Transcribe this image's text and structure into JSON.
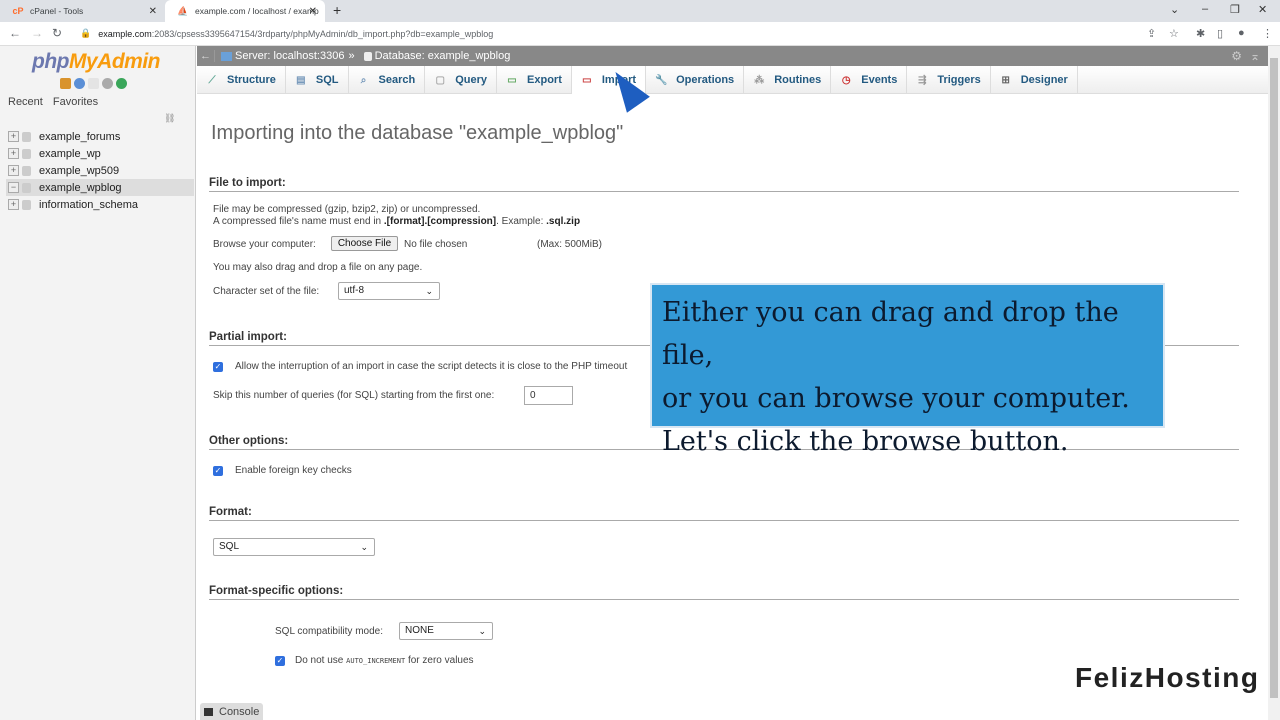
{
  "browser": {
    "tabs": [
      {
        "label": "cPanel - Tools",
        "active": false
      },
      {
        "label": "example.com / localhost / examp",
        "active": true
      }
    ],
    "url_host": "example.com",
    "url_rest": ":2083/cpsess3395647154/3rdparty/phpMyAdmin/db_import.php?db=example_wpblog"
  },
  "sidebar": {
    "logo_php": "php",
    "logo_myadmin": "MyAdmin",
    "tabs": [
      "Recent",
      "Favorites"
    ],
    "databases": [
      {
        "name": "example_forums",
        "expanded": false
      },
      {
        "name": "example_wp",
        "expanded": false
      },
      {
        "name": "example_wp509",
        "expanded": false
      },
      {
        "name": "example_wpblog",
        "expanded": true,
        "active": true
      },
      {
        "name": "information_schema",
        "expanded": false
      }
    ]
  },
  "breadcrumb": {
    "server": "Server: localhost:3306",
    "separator": "»",
    "database": "Database: example_wpblog"
  },
  "menu": [
    {
      "label": "Structure",
      "icon": "structure-icon"
    },
    {
      "label": "SQL",
      "icon": "sql-icon"
    },
    {
      "label": "Search",
      "icon": "search-icon"
    },
    {
      "label": "Query",
      "icon": "query-icon"
    },
    {
      "label": "Export",
      "icon": "export-icon"
    },
    {
      "label": "Import",
      "icon": "import-icon",
      "active": true
    },
    {
      "label": "Operations",
      "icon": "operations-icon"
    },
    {
      "label": "Routines",
      "icon": "routines-icon"
    },
    {
      "label": "Events",
      "icon": "events-icon"
    },
    {
      "label": "Triggers",
      "icon": "triggers-icon"
    },
    {
      "label": "Designer",
      "icon": "designer-icon"
    }
  ],
  "page": {
    "title": "Importing into the database \"example_wpblog\"",
    "file_section": "File to import:",
    "compress_line1": "File may be compressed (gzip, bzip2, zip) or uncompressed.",
    "compress_line2_a": "A compressed file's name must end in ",
    "compress_line2_b": ".[format].[compression]",
    "compress_line2_c": ". Example: ",
    "compress_line2_d": ".sql.zip",
    "browse_label": "Browse your computer:",
    "choose_file": "Choose File",
    "no_file": "No file chosen",
    "max": "(Max: 500MiB)",
    "drag_drop": "You may also drag and drop a file on any page.",
    "charset_label": "Character set of the file:",
    "charset_value": "utf-8",
    "partial_section": "Partial import:",
    "allow_interrupt": "Allow the interruption of an import in case the script detects it is close to the PHP timeout",
    "skip_label": "Skip this number of queries (for SQL) starting from the first one:",
    "skip_value": "0",
    "other_section": "Other options:",
    "fk_checks": "Enable foreign key checks",
    "format_section": "Format:",
    "format_value": "SQL",
    "format_specific_section": "Format-specific options:",
    "compat_label": "SQL compatibility mode:",
    "compat_value": "NONE",
    "no_autoinc_a": "Do not use ",
    "no_autoinc_b": "AUTO_INCREMENT",
    "no_autoinc_c": " for zero values",
    "console": "Console"
  },
  "overlay": {
    "caption_lines": [
      "Either you can drag and drop the file,",
      "or you can browse your computer.",
      "Let's click the browse button."
    ],
    "brand": "FelizHosting"
  }
}
